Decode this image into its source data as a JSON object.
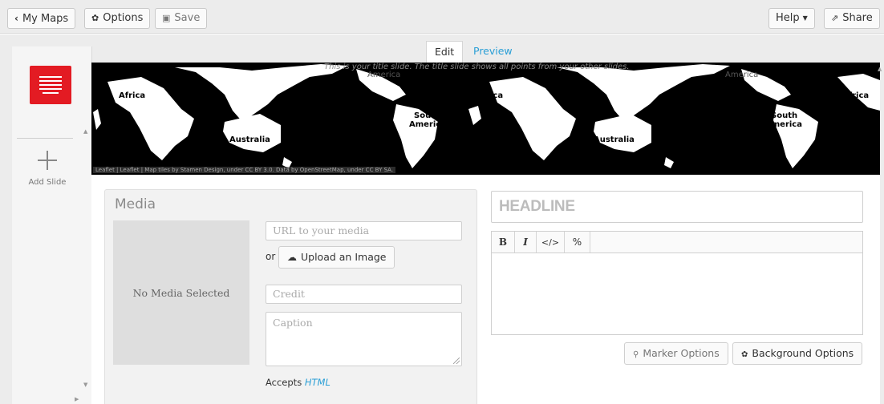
{
  "toolbar": {
    "my_maps": "My Maps",
    "options": "Options",
    "save": "Save",
    "help": "Help",
    "share": "Share"
  },
  "tabs": {
    "edit": "Edit",
    "preview": "Preview"
  },
  "slides": {
    "add_label": "Add Slide"
  },
  "map": {
    "ghost_text": "This is your title slide. The title slide shows all points from your other slides.",
    "attribution": "Leaflet | Leaflet | Map tiles by Stamen Design, under CC BY 3.0. Data by OpenStreetMap, under CC BY SA.",
    "labels": {
      "africa_left": "Africa",
      "australia_left": "Australia",
      "south_america_1": "South",
      "south_america_2": "America",
      "america_top": "America",
      "africa_mid": "Africa",
      "australia_right": "Australia",
      "south_america_r1": "South",
      "south_america_r2": "America",
      "america_top_right": "America",
      "africa_right": "Africa"
    }
  },
  "media": {
    "title": "Media",
    "no_media": "No Media Selected",
    "url_placeholder": "URL to your media",
    "or": "or",
    "upload": "Upload an Image",
    "credit_placeholder": "Credit",
    "caption_placeholder": "Caption",
    "accepts_prefix": "Accepts",
    "accepts_link": "HTML"
  },
  "text": {
    "headline_placeholder": "HEADLINE",
    "rte": {
      "bold": "B",
      "italic": "I",
      "code": "</>",
      "link": "%"
    }
  },
  "options": {
    "marker": "Marker Options",
    "background": "Background Options"
  },
  "colors": {
    "accent_red": "#e31b23",
    "link_blue": "#2a9fd6"
  }
}
